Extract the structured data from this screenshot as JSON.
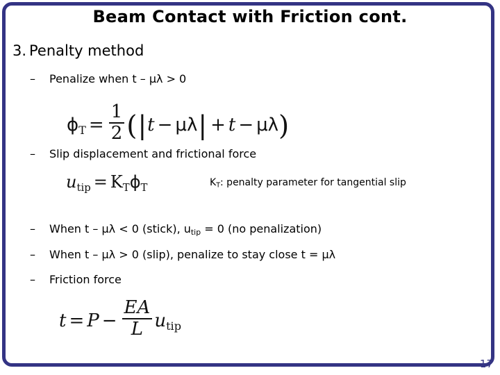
{
  "slide": {
    "title": "Beam Contact with Friction cont.",
    "page_number": "17",
    "frame_color": "#343484",
    "background_color": "#ffffff",
    "text_color": "#000000"
  },
  "content": {
    "item_number": "3.",
    "item_title": "Penalty method",
    "bullets": [
      {
        "dash": "–",
        "text_prefix": "Penalize when t – ",
        "symbol": "μλ",
        "text_suffix": " > 0",
        "full_text": "Penalize when t – μλ > 0"
      },
      {
        "dash": "–",
        "full_text": "Slip displacement and frictional force"
      },
      {
        "dash": "–",
        "full_text": "When t – μλ < 0 (stick), utip = 0 (no penalization)",
        "p1": "When t – ",
        "sym1": "μλ",
        "p2": " < 0 (stick), u",
        "sub1": "tip",
        "p3": " = 0 (no penalization)"
      },
      {
        "dash": "–",
        "full_text": "When t – μλ > 0 (slip), penalize to stay close t = μλ",
        "p1": "When t – ",
        "sym1": "μλ",
        "p2": " > 0 (slip), penalize to stay close t = ",
        "sym2": "μλ"
      },
      {
        "dash": "–",
        "full_text": "Friction force"
      }
    ],
    "annotation": {
      "symbol": "K",
      "symbol_sub": "T",
      "text": ": penalty parameter for tangential slip",
      "full_text": "KT: penalty parameter for tangential slip"
    }
  },
  "equations": {
    "phi": {
      "latex": "\\phi_T = \\frac{1}{2}\\left(\\left| t - \\mu\\lambda \\right| + t - \\mu\\lambda \\right)",
      "plain": "ϕT = 1/2 ( | t – μλ | + t – μλ )",
      "lhs_symbol": "ϕ",
      "lhs_sub": "T",
      "equals": "=",
      "num": "1",
      "den": "2",
      "open_paren": "(",
      "abs_bar": "|",
      "t1": "t",
      "minus1": "−",
      "mu_lambda_1": "μλ",
      "plus": "+",
      "t2": "t",
      "minus2": "−",
      "mu_lambda_2": "μλ",
      "close_paren": ")"
    },
    "utip": {
      "latex": "u_{tip} = K_T \\phi_T",
      "plain": "utip = KT ϕT",
      "u": "u",
      "u_sub": "tip",
      "equals": "=",
      "K": "K",
      "K_sub": "T",
      "phi": "ϕ",
      "phi_sub": "T"
    },
    "force": {
      "latex": "t = P - \\frac{EA}{L} u_{tip}",
      "plain": "t = P – EA/L utip",
      "t": "t",
      "equals": "=",
      "P": "P",
      "minus": "−",
      "num": "EA",
      "den": "L",
      "u": "u",
      "u_sub": "tip"
    }
  }
}
